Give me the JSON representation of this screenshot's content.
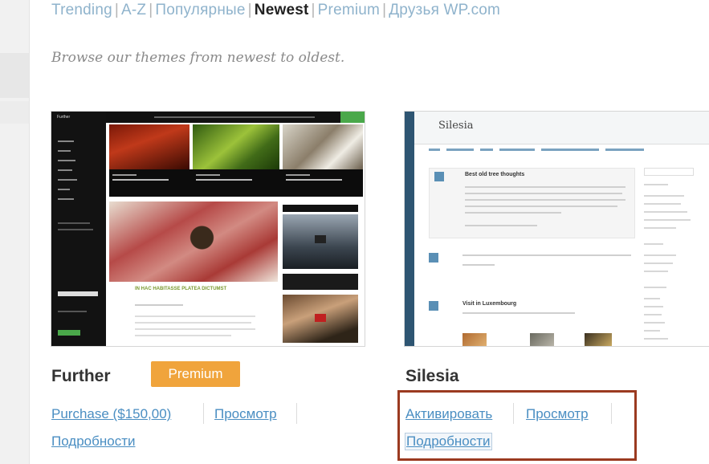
{
  "filter_nav": {
    "items": [
      "Trending",
      "A-Z",
      "Популярные",
      "Newest",
      "Premium",
      "Друзья WP.com"
    ],
    "current": "Newest"
  },
  "description": "Browse our themes from newest to oldest.",
  "themes": [
    {
      "name": "Further",
      "badge": "Premium",
      "actions": {
        "purchase": "Purchase ($150,00)",
        "preview": "Просмотр",
        "details": "Подробности"
      },
      "preview_text": {
        "site_title": "Further",
        "post_title": "IN HAC HABITASSE PLATEA DICTUMST"
      }
    },
    {
      "name": "Silesia",
      "actions": {
        "activate": "Активировать",
        "preview": "Просмотр",
        "details": "Подробности"
      },
      "preview_text": {
        "site_title": "Silesia",
        "post_title_1": "Best old tree thoughts",
        "post_title_2": "Visit in Luxembourg"
      }
    }
  ],
  "colors": {
    "link": "#4a8ec2",
    "premium_badge": "#f0a43c",
    "highlight_border": "#9b3a20",
    "further_accent": "#4aa84a",
    "silesia_accent": "#2e5572"
  }
}
